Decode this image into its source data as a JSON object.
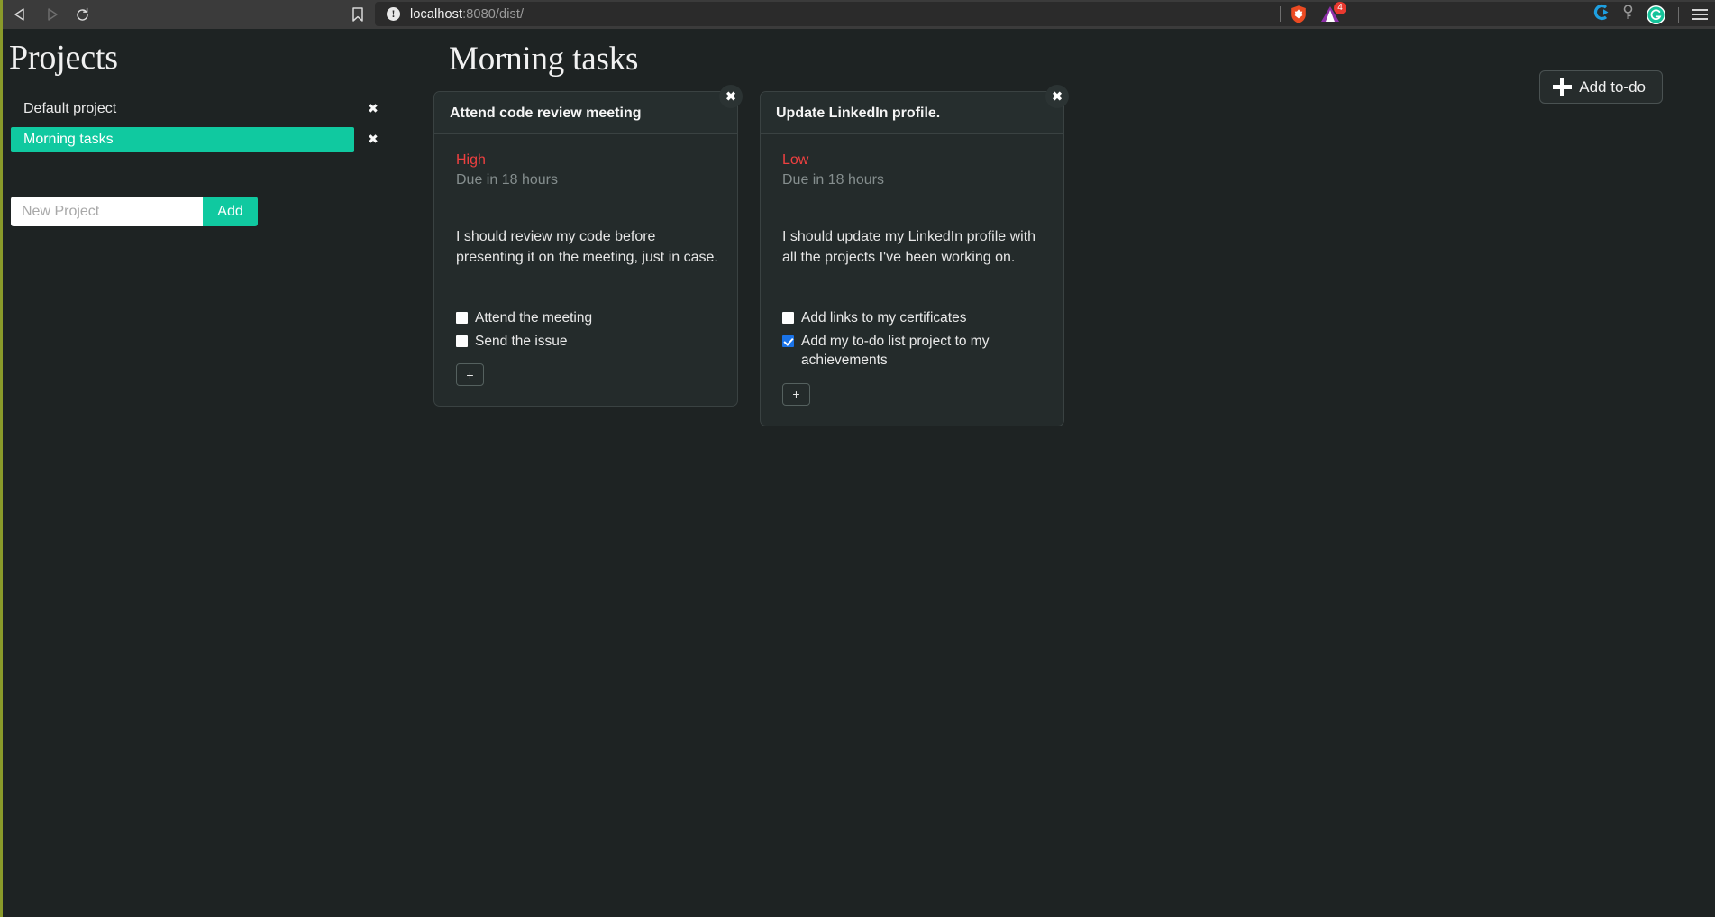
{
  "browser": {
    "nav": {
      "back_icon": "back-arrow-icon",
      "forward_icon": "forward-arrow-icon",
      "reload_icon": "reload-icon"
    },
    "bookmark_icon": "bookmark-icon",
    "site_info_icon": "site-info-icon",
    "site_info_glyph": "!",
    "url_host": "localhost",
    "url_path": ":8080/dist/",
    "url_full": "localhost:8080/dist/",
    "shield_icon": "brave-shield-icon",
    "extension_icon": "extension-triangle-icon",
    "extension_badge": "4",
    "profile_c_icon": "c-profile-icon",
    "key_icon": "key-icon",
    "grammarly_icon": "grammarly-icon",
    "grammarly_glyph": "G",
    "menu_icon": "hamburger-menu-icon",
    "accent_color": "#8a9a2a"
  },
  "sidebar": {
    "title": "Projects",
    "projects": [
      {
        "name": "Default project",
        "selected": false,
        "delete_glyph": "✖"
      },
      {
        "name": "Morning tasks",
        "selected": true,
        "delete_glyph": "✖"
      }
    ],
    "new_project_placeholder": "New Project",
    "new_project_value": "",
    "add_button_label": "Add",
    "selected_color": "#10c9a0"
  },
  "main": {
    "title": "Morning tasks",
    "add_todo_label": "Add to-do",
    "add_todo_icon": "plus-icon",
    "todos": [
      {
        "title": "Attend code review meeting",
        "close_glyph": "✖",
        "priority": "High",
        "priority_color": "#ef4040",
        "due": "Due in 18 hours",
        "description": "I should review my code before presenting it on the meeting, just in case.",
        "checklist": [
          {
            "label": "Attend the meeting",
            "checked": false
          },
          {
            "label": "Send the issue",
            "checked": false
          }
        ],
        "add_check_label": "+"
      },
      {
        "title": "Update LinkedIn profile.",
        "close_glyph": "✖",
        "priority": "Low",
        "priority_color": "#ef4040",
        "due": "Due in 18 hours",
        "description": "I should update my LinkedIn profile with all the projects I've been working on.",
        "checklist": [
          {
            "label": "Add links to my certificates",
            "checked": false
          },
          {
            "label": "Add my to-do list project to my achievements",
            "checked": true
          }
        ],
        "add_check_label": "+"
      }
    ]
  },
  "theme": {
    "page_background": "#1e2323",
    "card_background": "#242b2b",
    "card_header_background": "#262e2e",
    "chrome_background": "#3b3b3b"
  }
}
